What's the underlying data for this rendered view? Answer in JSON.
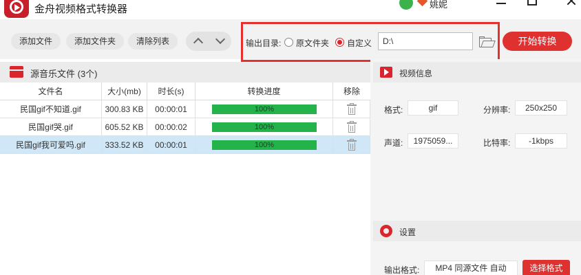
{
  "app": {
    "title": "金舟视频格式转换器",
    "user_name": "姚妮"
  },
  "toolbar": {
    "add_file": "添加文件",
    "add_folder": "添加文件夹",
    "clear_list": "清除列表"
  },
  "output": {
    "label": "输出目录:",
    "option_original": "原文件夹",
    "option_custom": "自定义",
    "selected": "自定义",
    "path": "D:\\",
    "convert_button": "开始转换"
  },
  "file_list": {
    "header": "源音乐文件 (3个)",
    "columns": [
      "文件名",
      "大小(mb)",
      "时长(s)",
      "转换进度",
      "移除"
    ],
    "rows": [
      {
        "name": "民国gif不知道.gif",
        "size": "300.83 KB",
        "duration": "00:00:01",
        "progress": "100%"
      },
      {
        "name": "民国gif哭.gif",
        "size": "605.52 KB",
        "duration": "00:00:02",
        "progress": "100%"
      },
      {
        "name": "民国gif我可爱吗.gif",
        "size": "333.52 KB",
        "duration": "00:00:01",
        "progress": "100%"
      }
    ],
    "selected_row": 2
  },
  "video_info": {
    "header": "视频信息",
    "format_label": "格式:",
    "format_value": "gif",
    "resolution_label": "分辨率:",
    "resolution_value": "250x250",
    "channel_label": "声道:",
    "channel_value": "1975059...",
    "bitrate_label": "比特率:",
    "bitrate_value": "-1kbps"
  },
  "settings": {
    "header": "设置",
    "output_format_label": "输出格式:",
    "output_format_value": "MP4 同源文件 自动",
    "select_format_button": "选择格式"
  },
  "colors": {
    "accent": "#e03131",
    "progress": "#24b24a",
    "selected_row": "#cfe7f7"
  }
}
